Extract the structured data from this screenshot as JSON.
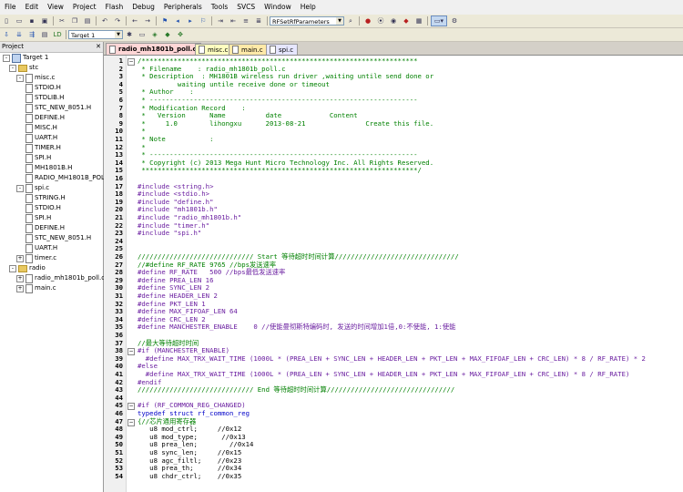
{
  "menu": [
    "File",
    "Edit",
    "View",
    "Project",
    "Flash",
    "Debug",
    "Peripherals",
    "Tools",
    "SVCS",
    "Window",
    "Help"
  ],
  "toolbar": {
    "target_select": "Target 1",
    "function_select": "RFSetRfParameters"
  },
  "project_panel": {
    "title": "Project",
    "tree": [
      {
        "label": "Target 1",
        "level": 0,
        "type": "project",
        "toggle": "-"
      },
      {
        "label": "stc",
        "level": 1,
        "type": "folder",
        "toggle": "-"
      },
      {
        "label": "misc.c",
        "level": 2,
        "type": "file",
        "toggle": "-"
      },
      {
        "label": "STDIO.H",
        "level": 3,
        "type": "file"
      },
      {
        "label": "STDLIB.H",
        "level": 3,
        "type": "file"
      },
      {
        "label": "STC_NEW_8051.H",
        "level": 3,
        "type": "file"
      },
      {
        "label": "DEFINE.H",
        "level": 3,
        "type": "file"
      },
      {
        "label": "MISC.H",
        "level": 3,
        "type": "file"
      },
      {
        "label": "UART.H",
        "level": 3,
        "type": "file"
      },
      {
        "label": "TIMER.H",
        "level": 3,
        "type": "file"
      },
      {
        "label": "SPI.H",
        "level": 3,
        "type": "file"
      },
      {
        "label": "MH1801B.H",
        "level": 3,
        "type": "file"
      },
      {
        "label": "RADIO_MH1801B_POLL.H",
        "level": 3,
        "type": "file"
      },
      {
        "label": "spi.c",
        "level": 2,
        "type": "file",
        "toggle": "-"
      },
      {
        "label": "STRING.H",
        "level": 3,
        "type": "file"
      },
      {
        "label": "STDIO.H",
        "level": 3,
        "type": "file"
      },
      {
        "label": "SPI.H",
        "level": 3,
        "type": "file"
      },
      {
        "label": "DEFINE.H",
        "level": 3,
        "type": "file"
      },
      {
        "label": "STC_NEW_8051.H",
        "level": 3,
        "type": "file"
      },
      {
        "label": "UART.H",
        "level": 3,
        "type": "file"
      },
      {
        "label": "timer.c",
        "level": 2,
        "type": "file",
        "toggle": "+"
      },
      {
        "label": "radio",
        "level": 1,
        "type": "folder",
        "toggle": "-"
      },
      {
        "label": "radio_mh1801b_poll.c",
        "level": 2,
        "type": "file",
        "toggle": "+"
      },
      {
        "label": "main.c",
        "level": 2,
        "type": "file",
        "toggle": "+"
      }
    ]
  },
  "tabs": [
    {
      "label": "radio_mh1801b_poll.c",
      "color": "#ffd6d6",
      "active": true
    },
    {
      "label": "misc.c",
      "color": "#ffffc0",
      "active": false
    },
    {
      "label": "main.c",
      "color": "#ffe9a8",
      "active": false
    },
    {
      "label": "spi.c",
      "color": "#e6e6ff",
      "active": false
    }
  ],
  "colors": {
    "comment": "#008000",
    "preprocessor": "#6a1ea0",
    "keyword": "#0000c8"
  },
  "code_lines": [
    {
      "n": "1",
      "t": "/*********************************************************************",
      "c": "comment"
    },
    {
      "n": "2",
      "t": " * Filename    : radio_mh1801b_poll.c",
      "c": "comment"
    },
    {
      "n": "3",
      "t": " * Description  : MH1801B wireless run driver ,waiting untile send done or",
      "c": "comment"
    },
    {
      "n": "4",
      "t": "          waiting untile receive done or timeout",
      "c": "comment"
    },
    {
      "n": "5",
      "t": " * Author    :",
      "c": "comment"
    },
    {
      "n": "6",
      "t": " * -------------------------------------------------------------------",
      "c": "comment"
    },
    {
      "n": "7",
      "t": " * Modification Record    :",
      "c": "comment"
    },
    {
      "n": "8",
      "t": " *   Version      Name          date            Content",
      "c": "comment"
    },
    {
      "n": "9",
      "t": " *     1.0        lihongxu      2013-08-21               Create this file.",
      "c": "comment"
    },
    {
      "n": "10",
      "t": " *",
      "c": "comment"
    },
    {
      "n": "11",
      "t": " * Note           :",
      "c": "comment"
    },
    {
      "n": "12",
      "t": " *",
      "c": "comment"
    },
    {
      "n": "13",
      "t": " * -------------------------------------------------------------------",
      "c": "comment"
    },
    {
      "n": "14",
      "t": " * Copyright (c) 2013 Mega Hunt Micro Technology Inc. All Rights Reserved.",
      "c": "comment"
    },
    {
      "n": "15",
      "t": " *********************************************************************/",
      "c": "comment"
    },
    {
      "n": "16",
      "t": "",
      "c": "plain"
    },
    {
      "n": "17",
      "t": "#include <string.h>",
      "c": "pre"
    },
    {
      "n": "18",
      "t": "#include <stdio.h>",
      "c": "pre"
    },
    {
      "n": "19",
      "t": "#include \"define.h\"",
      "c": "pre"
    },
    {
      "n": "20",
      "t": "#include \"mh1801b.h\"",
      "c": "pre"
    },
    {
      "n": "21",
      "t": "#include \"radio_mh1801b.h\"",
      "c": "pre"
    },
    {
      "n": "22",
      "t": "#include \"timer.h\"",
      "c": "pre"
    },
    {
      "n": "23",
      "t": "#include \"spi.h\"",
      "c": "pre"
    },
    {
      "n": "24",
      "t": "",
      "c": "plain"
    },
    {
      "n": "25",
      "t": "",
      "c": "plain"
    },
    {
      "n": "26",
      "t": "///////////////////////////// Start 等待超时时间计算///////////////////////////////",
      "c": "comment"
    },
    {
      "n": "27",
      "t": "//#define RF_RATE 9765 //bps发送速率",
      "c": "comment"
    },
    {
      "n": "28",
      "t": "#define RF_RATE   500 //bps最低发送速率",
      "c": "pre"
    },
    {
      "n": "29",
      "t": "#define PREA_LEN 16",
      "c": "pre"
    },
    {
      "n": "30",
      "t": "#define SYNC_LEN 2",
      "c": "pre"
    },
    {
      "n": "31",
      "t": "#define HEADER_LEN 2",
      "c": "pre"
    },
    {
      "n": "32",
      "t": "#define PKT_LEN 1",
      "c": "pre"
    },
    {
      "n": "33",
      "t": "#define MAX_FIFOAF_LEN 64",
      "c": "pre"
    },
    {
      "n": "34",
      "t": "#define CRC_LEN 2",
      "c": "pre"
    },
    {
      "n": "35",
      "t": "#define MANCHESTER_ENABLE    0 //使能曼彻斯特编码时, 发送的时间增加1倍,0:不使能, 1:使能",
      "c": "pre"
    },
    {
      "n": "36",
      "t": "",
      "c": "plain"
    },
    {
      "n": "37",
      "t": "//最大等待超时时间",
      "c": "comment"
    },
    {
      "n": "38",
      "t": "#if (MANCHESTER_ENABLE)",
      "c": "pre"
    },
    {
      "n": "39",
      "t": "  #define MAX_TRX_WAIT_TIME (1000L * (PREA_LEN + SYNC_LEN + HEADER_LEN + PKT_LEN + MAX_FIFOAF_LEN + CRC_LEN) * 8 / RF_RATE) * 2",
      "c": "pre"
    },
    {
      "n": "40",
      "t": "#else",
      "c": "pre"
    },
    {
      "n": "41",
      "t": "  #define MAX_TRX_WAIT_TIME (1000L * (PREA_LEN + SYNC_LEN + HEADER_LEN + PKT_LEN + MAX_FIFOAF_LEN + CRC_LEN) * 8 / RF_RATE)",
      "c": "pre"
    },
    {
      "n": "42",
      "t": "#endif",
      "c": "pre"
    },
    {
      "n": "43",
      "t": "///////////////////////////// End 等待超时时间计算////////////////////////////////",
      "c": "comment"
    },
    {
      "n": "44",
      "t": "",
      "c": "plain"
    },
    {
      "n": "45",
      "t": "#if (RF_COMMON_REG_CHANGED)",
      "c": "pre"
    },
    {
      "n": "46",
      "t": "typedef struct rf_common_reg",
      "c": "key"
    },
    {
      "n": "47",
      "t": "{//芯片通用寄存器",
      "c": "comment"
    },
    {
      "n": "48",
      "t": "   u8 mod_ctrl;     //0x12",
      "c": "plain"
    },
    {
      "n": "49",
      "t": "   u8 mod_type;      //0x13",
      "c": "plain"
    },
    {
      "n": "50",
      "t": "   u8 prea_len;        //0x14",
      "c": "plain"
    },
    {
      "n": "51",
      "t": "   u8 sync_len;     //0x15",
      "c": "plain"
    },
    {
      "n": "52",
      "t": "   u8 agc_filtl;    //0x23",
      "c": "plain"
    },
    {
      "n": "53",
      "t": "   u8 prea_th;      //0x34",
      "c": "plain"
    },
    {
      "n": "54",
      "t": "   u8 chdr_ctrl;    //0x35",
      "c": "plain"
    }
  ]
}
